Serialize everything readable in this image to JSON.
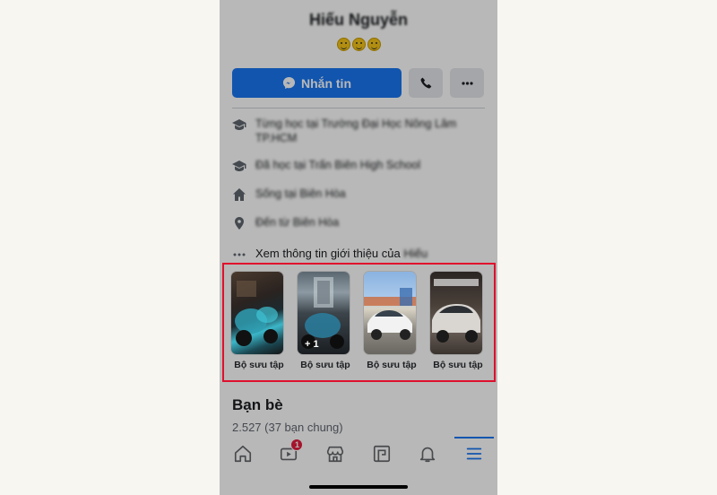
{
  "profile": {
    "name": "Hiếu Nguyễn"
  },
  "actions": {
    "message_label": "Nhắn tin"
  },
  "info": [
    {
      "icon": "graduation-cap-icon",
      "text": "Từng học tại Trường Đại Học Nông Lâm TP.HCM"
    },
    {
      "icon": "graduation-cap-icon",
      "text": "Đã học tại Trấn Biên High School"
    },
    {
      "icon": "home-icon",
      "text": "Sống tại Biên Hòa"
    },
    {
      "icon": "location-pin-icon",
      "text": "Đến từ Biên Hòa"
    }
  ],
  "see_intro": {
    "label": "Xem thông tin giới thiệu của",
    "name_suffix": "Hiếu"
  },
  "albums": [
    {
      "label": "Bộ sưu tập",
      "extra": ""
    },
    {
      "label": "Bộ sưu tập",
      "extra": "+ 1"
    },
    {
      "label": "Bộ sưu tập",
      "extra": ""
    },
    {
      "label": "Bộ sưu tập",
      "extra": ""
    }
  ],
  "friends": {
    "title": "Bạn bè",
    "count": "2.527 (37 bạn chung)"
  },
  "tabbar": {
    "watch_badge": "1"
  },
  "colors": {
    "facebook_blue": "#1877f2",
    "highlight_red": "#e0102e",
    "badge_red": "#e41e3f"
  }
}
